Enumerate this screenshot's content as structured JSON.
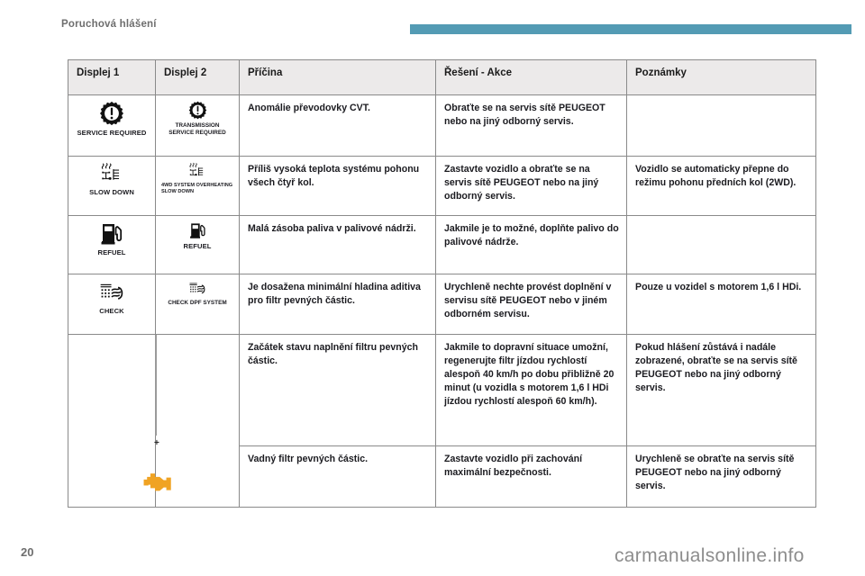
{
  "header": {
    "title": "Poruchová hlášení",
    "accent_color": "#539bb4"
  },
  "table": {
    "columns": [
      {
        "label": "Displej 1"
      },
      {
        "label": "Displej 2"
      },
      {
        "label": "Příčina"
      },
      {
        "label": "Řešení - Akce"
      },
      {
        "label": "Poznámky"
      }
    ],
    "rows": [
      {
        "display1": {
          "icon": "gear-exclamation-icon",
          "label": "SERVICE REQUIRED"
        },
        "display2": {
          "icon": "gear-exclamation-icon",
          "label": "TRANSMISSION\nSERVICE REQUIRED"
        },
        "cause": "Anomálie převodovky CVT.",
        "action": "Obraťte se na servis sítě PEUGEOT nebo na jiný odborný servis.",
        "notes": ""
      },
      {
        "display1": {
          "icon": "4wd-overheat-icon",
          "label": "SLOW DOWN"
        },
        "display2": {
          "icon": "4wd-overheat-icon",
          "label": "4WD SYSTEM OVERHEATING\nSLOW DOWN"
        },
        "cause": "Příliš vysoká teplota systému pohonu všech čtyř kol.",
        "action": "Zastavte vozidlo a obraťte se na servis sítě PEUGEOT nebo na jiný odborný servis.",
        "notes": "Vozidlo se automaticky přepne do režimu pohonu předních kol (2WD)."
      },
      {
        "display1": {
          "icon": "fuel-pump-icon",
          "label": "REFUEL"
        },
        "display2": {
          "icon": "fuel-pump-icon",
          "label": "REFUEL"
        },
        "cause": "Malá zásoba paliva v palivové nádrži.",
        "action": "Jakmile je to možné, doplňte palivo do palivové nádrže.",
        "notes": ""
      },
      {
        "display1": {
          "icon": "particle-filter-icon",
          "label": "CHECK"
        },
        "display2": {
          "icon": "particle-filter-icon",
          "label": "CHECK DPF SYSTEM"
        },
        "cause": "Je dosažena minimální hladina aditiva pro filtr pevných částic.",
        "action": "Urychleně nechte provést doplnění v servisu sítě PEUGEOT nebo v jiném odborném servisu.",
        "notes": "Pouze u vozidel s motorem 1,6 l HDi."
      },
      {
        "display1": {
          "icon": "",
          "label": ""
        },
        "display2": {
          "icon": "engine-warning-lamp",
          "label": ""
        },
        "cause": "Začátek stavu naplnění filtru pevných částic.",
        "action": "Jakmile to dopravní situace umožní, regenerujte filtr jízdou rychlostí alespoň 40 km/h po dobu přibližně 20 minut (u vozidla s motorem 1,6 l HDi jízdou rychlostí alespoň 60 km/h).",
        "notes": "Pokud hlášení zůstává i nadále zobrazené, obraťte se na servis sítě PEUGEOT nebo na jiný odborný servis."
      },
      {
        "display1": {
          "icon": "",
          "label": ""
        },
        "display2": {
          "icon": "",
          "label": ""
        },
        "cause": "Vadný filtr pevných částic.",
        "action": "Zastavte vozidlo při zachování maximální bezpečnosti.",
        "notes": "Urychleně se obraťte na servis sítě PEUGEOT nebo na jiný odborný servis."
      }
    ]
  },
  "footer": {
    "page_number": "20",
    "watermark": "carmanualsonline.info"
  }
}
